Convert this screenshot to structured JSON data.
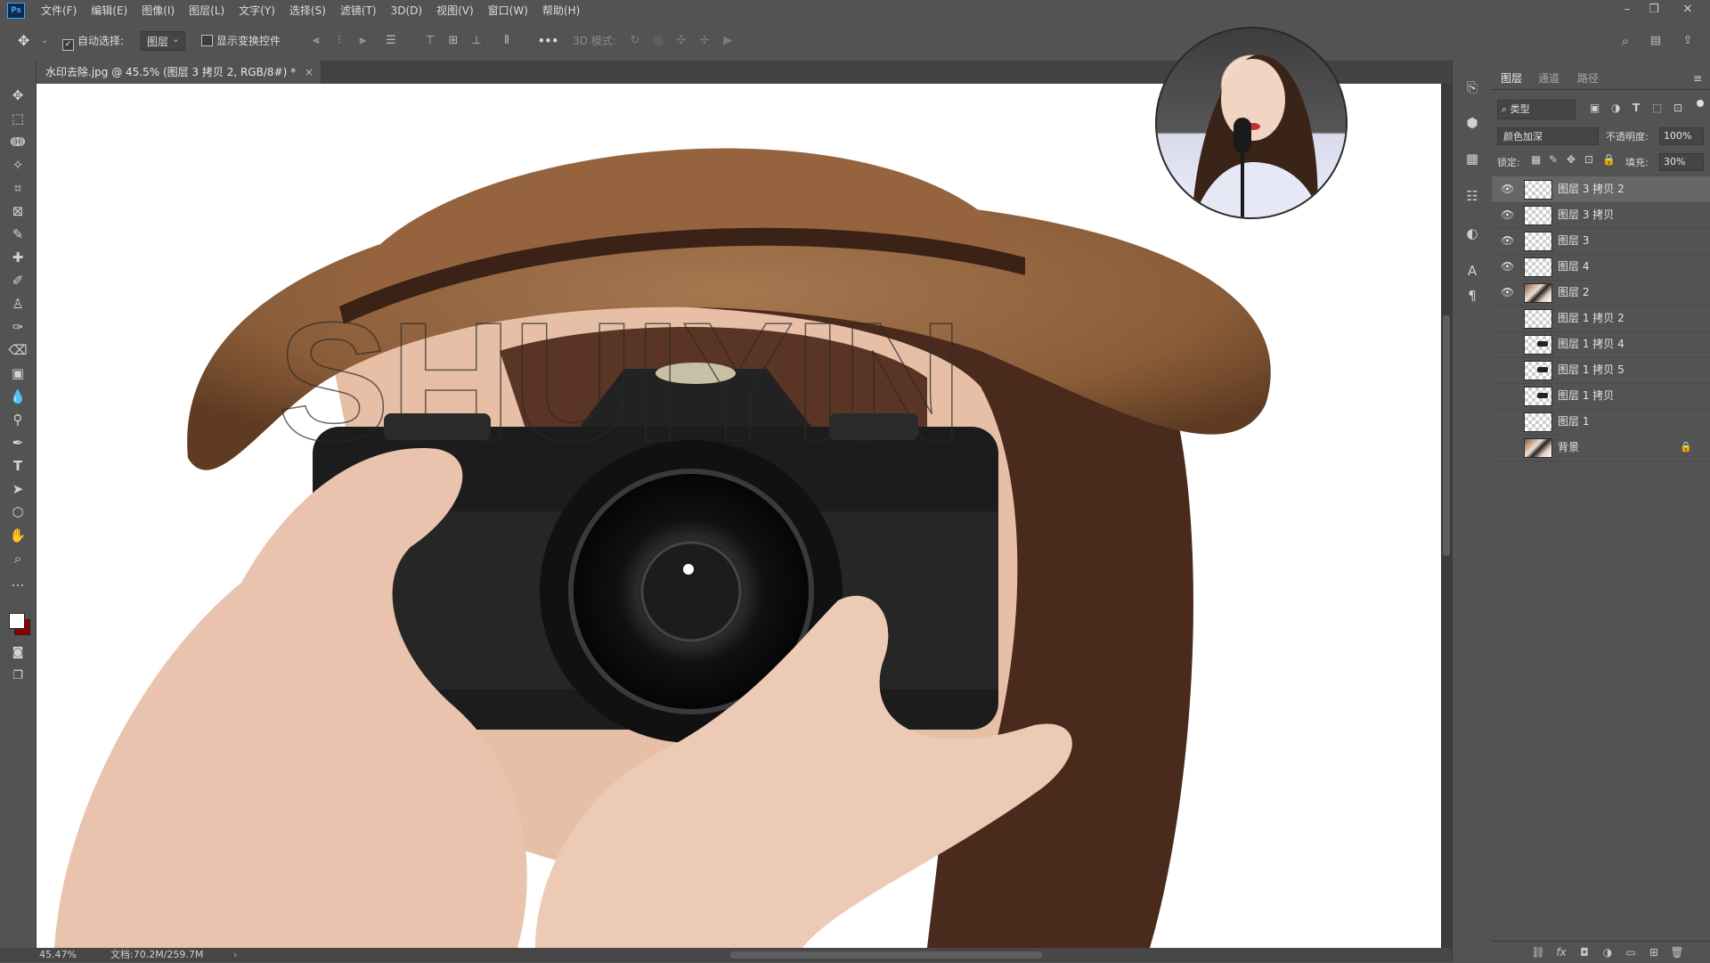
{
  "app": {
    "logo": "Ps"
  },
  "menu": [
    "文件(F)",
    "编辑(E)",
    "图像(I)",
    "图层(L)",
    "文字(Y)",
    "选择(S)",
    "滤镜(T)",
    "3D(D)",
    "视图(V)",
    "窗口(W)",
    "帮助(H)"
  ],
  "window_controls": {
    "minimize": "–",
    "restore": "❐",
    "close": "✕"
  },
  "options": {
    "auto_select_label": "自动选择:",
    "auto_select_checked": true,
    "auto_select_target": "图层",
    "show_transform_label": "显示变换控件",
    "more": "•••",
    "mode_3d_label": "3D 模式:"
  },
  "document": {
    "tab_title": "水印去除.jpg @ 45.5% (图层 3 拷贝 2, RGB/8#) *",
    "watermark_text": "SHUIYIN"
  },
  "status": {
    "zoom": "45.47%",
    "doc_info": "文档:70.2M/259.7M"
  },
  "layers_panel": {
    "tabs": [
      {
        "label": "图层",
        "active": true
      },
      {
        "label": "通道",
        "active": false
      },
      {
        "label": "路径",
        "active": false
      }
    ],
    "filter_kind": "类型",
    "blend_mode": "颜色加深",
    "opacity_label": "不透明度:",
    "opacity_value": "100%",
    "lock_label": "锁定:",
    "fill_label": "填充:",
    "fill_value": "30%",
    "layers": [
      {
        "name": "图层 3 拷贝 2",
        "visible": true,
        "active": true,
        "thumb": "transparent"
      },
      {
        "name": "图层 3 拷贝",
        "visible": true,
        "active": false,
        "thumb": "transparent"
      },
      {
        "name": "图层 3",
        "visible": true,
        "active": false,
        "thumb": "transparent"
      },
      {
        "name": "图层 4",
        "visible": true,
        "active": false,
        "thumb": "transparent"
      },
      {
        "name": "图层 2",
        "visible": true,
        "active": false,
        "thumb": "image"
      },
      {
        "name": "图层 1 拷贝 2",
        "visible": false,
        "active": false,
        "thumb": "transparent"
      },
      {
        "name": "图层 1 拷贝 4",
        "visible": false,
        "active": false,
        "thumb": "partial"
      },
      {
        "name": "图层 1 拷贝 5",
        "visible": false,
        "active": false,
        "thumb": "partial"
      },
      {
        "name": "图层 1 拷贝",
        "visible": false,
        "active": false,
        "thumb": "partial"
      },
      {
        "name": "图层 1",
        "visible": false,
        "active": false,
        "thumb": "transparent"
      },
      {
        "name": "背景",
        "visible": false,
        "active": false,
        "thumb": "image",
        "locked": true
      }
    ]
  },
  "icons": {
    "toolbar": [
      "move-icon",
      "marquee-icon",
      "lasso-icon",
      "magic-wand-icon",
      "crop-icon",
      "frame-icon",
      "eyedropper-icon",
      "healing-brush-icon",
      "brush-icon",
      "clone-stamp-icon",
      "history-brush-icon",
      "eraser-icon",
      "gradient-icon",
      "blur-icon",
      "dodge-icon",
      "pen-icon",
      "type-icon",
      "path-select-icon",
      "shape-icon",
      "hand-icon",
      "zoom-icon",
      "more-tools-icon"
    ]
  },
  "colors": {
    "ui_bg": "#535353",
    "accent": "#31a8ff",
    "foreground_swatch": "#ffffff",
    "background_swatch": "#8b0000"
  }
}
